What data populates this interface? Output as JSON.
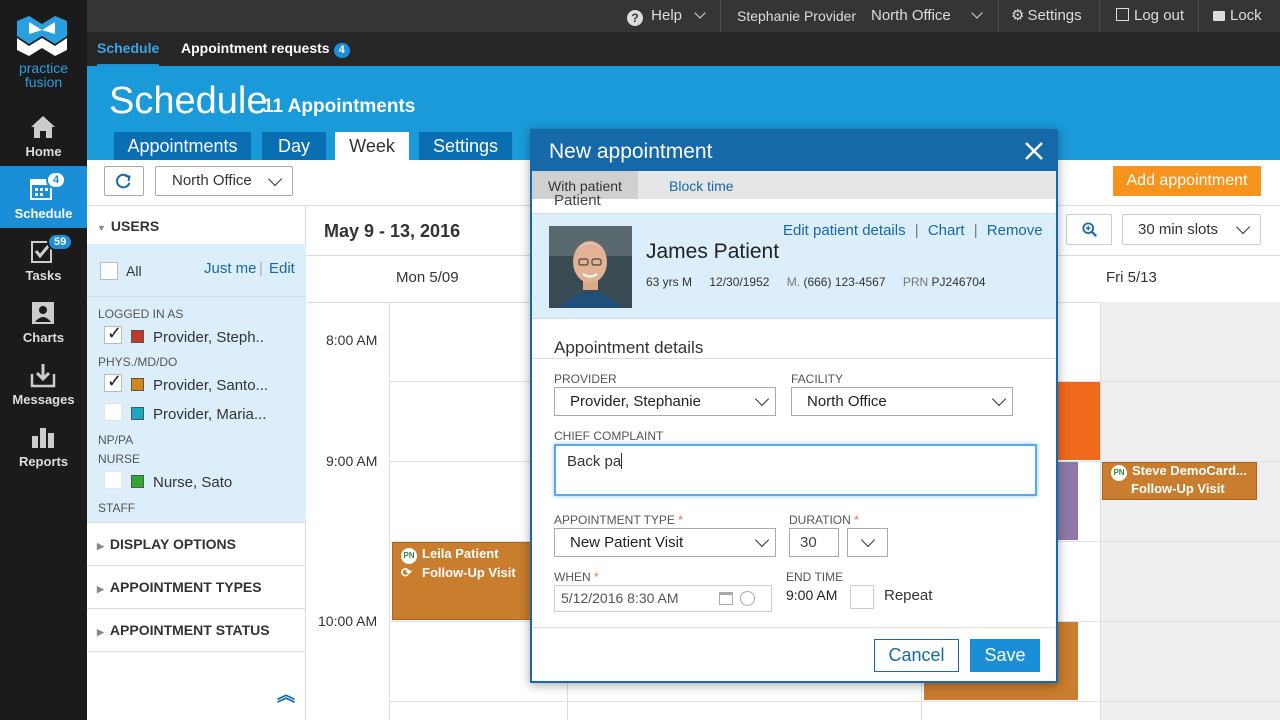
{
  "brand": {
    "name_line1": "practice",
    "name_line2": "fusion"
  },
  "nav": [
    {
      "label": "Home",
      "icon": "home-icon"
    },
    {
      "label": "Schedule",
      "icon": "calendar-icon",
      "badge": "4"
    },
    {
      "label": "Tasks",
      "icon": "tasks-icon",
      "badge": "59"
    },
    {
      "label": "Charts",
      "icon": "charts-icon"
    },
    {
      "label": "Messages",
      "icon": "messages-icon"
    },
    {
      "label": "Reports",
      "icon": "reports-icon"
    }
  ],
  "topbar": {
    "help": "Help",
    "user": "Stephanie Provider",
    "office": "North Office",
    "settings": "Settings",
    "logout": "Log out",
    "lock": "Lock"
  },
  "subnav": {
    "schedule": "Schedule",
    "requests": "Appointment requests",
    "requests_badge": "4"
  },
  "header": {
    "title": "Schedule",
    "subtitle": "11 Appointments",
    "tabs": [
      "Appointments",
      "Day",
      "Week",
      "Settings"
    ],
    "active_tab": "Week"
  },
  "toolbar": {
    "office": "North Office",
    "add_button": "Add appointment",
    "slots": "30 min slots"
  },
  "sidebar": {
    "users_heading": "USERS",
    "all": "All",
    "just_me": "Just me",
    "edit": "Edit",
    "logged_in_as": "LOGGED IN AS",
    "phys": "PHYS./MD/DO",
    "np": "NP/PA",
    "nurse": "NURSE",
    "staff": "STAFF",
    "users": [
      {
        "name": "Provider, Steph..",
        "color": "#c0392b",
        "checked": true
      },
      {
        "name": "Provider, Santo...",
        "color": "#d4861e",
        "checked": true
      },
      {
        "name": "Provider, Maria...",
        "color": "#1ba7c4",
        "checked": false
      },
      {
        "name": "Nurse, Sato",
        "color": "#2ea82e",
        "checked": false
      }
    ],
    "sections": [
      "DISPLAY OPTIONS",
      "APPOINTMENT TYPES",
      "APPOINTMENT STATUS"
    ]
  },
  "calendar": {
    "range": "May 9 - 13, 2016",
    "days": [
      "Mon 5/09",
      "Fri 5/13"
    ],
    "times": [
      "8:00 AM",
      "9:00 AM",
      "10:00 AM"
    ],
    "events": [
      {
        "badge": "PN",
        "name": "Leila Patient",
        "type": "Follow-Up Visit"
      },
      {
        "badge": "PN",
        "name": "Steve DemoCard...",
        "type": "Follow-Up Visit"
      }
    ]
  },
  "modal": {
    "title": "New appointment",
    "tabs": [
      "With patient",
      "Block time"
    ],
    "patient_section": "Patient",
    "patient": {
      "name": "James Patient",
      "age": "63 yrs M",
      "dob": "12/30/1952",
      "phone_label": "M.",
      "phone": "(666) 123-4567",
      "prn_label": "PRN",
      "prn": "PJ246704"
    },
    "links": {
      "edit": "Edit patient details",
      "chart": "Chart",
      "remove": "Remove"
    },
    "details_heading": "Appointment details",
    "provider_label": "PROVIDER",
    "provider_value": "Provider, Stephanie",
    "facility_label": "FACILITY",
    "facility_value": "North Office",
    "complaint_label": "CHIEF COMPLAINT",
    "complaint_value": "Back pa",
    "type_label": "APPOINTMENT TYPE",
    "type_value": "New Patient Visit",
    "duration_label": "DURATION",
    "duration_value": "30",
    "when_label": "WHEN",
    "when_value": "5/12/2016 8:30 AM",
    "end_label": "END TIME",
    "end_value": "9:00 AM",
    "repeat": "Repeat",
    "cancel": "Cancel",
    "save": "Save",
    "required_mark": "*"
  },
  "colors": {
    "accent": "#1a9ad9",
    "orange": "#f7941d",
    "event": "#c97d2e",
    "modal_header": "#1569a8"
  }
}
